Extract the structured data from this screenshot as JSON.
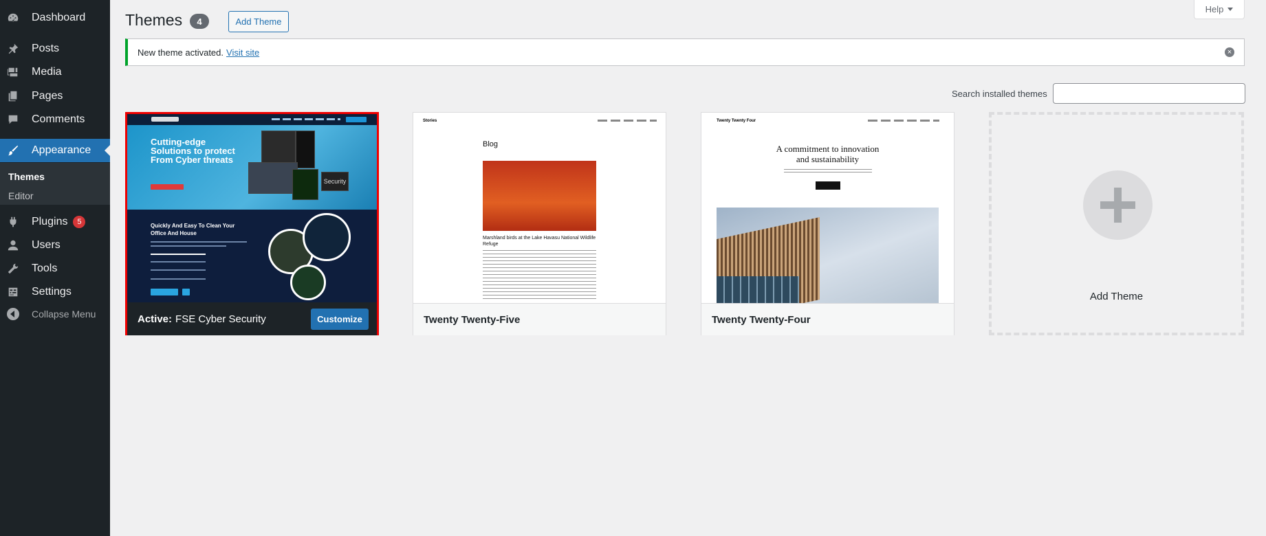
{
  "sidebar": {
    "items": [
      {
        "key": "dashboard",
        "label": "Dashboard",
        "icon": "dashboard-icon"
      },
      {
        "key": "posts",
        "label": "Posts",
        "icon": "pin-icon"
      },
      {
        "key": "media",
        "label": "Media",
        "icon": "media-icon"
      },
      {
        "key": "pages",
        "label": "Pages",
        "icon": "pages-icon"
      },
      {
        "key": "comments",
        "label": "Comments",
        "icon": "comment-icon"
      },
      {
        "key": "appearance",
        "label": "Appearance",
        "icon": "paintbrush-icon"
      },
      {
        "key": "plugins",
        "label": "Plugins",
        "icon": "plug-icon",
        "badge": "5"
      },
      {
        "key": "users",
        "label": "Users",
        "icon": "user-icon"
      },
      {
        "key": "tools",
        "label": "Tools",
        "icon": "wrench-icon"
      },
      {
        "key": "settings",
        "label": "Settings",
        "icon": "settings-icon"
      }
    ],
    "submenu": [
      "Themes",
      "Editor"
    ],
    "collapse_label": "Collapse Menu"
  },
  "header": {
    "title": "Themes",
    "count": "4",
    "add_button": "Add Theme",
    "help": "Help"
  },
  "notice": {
    "text": "New theme activated.",
    "link": "Visit site"
  },
  "search": {
    "label": "Search installed themes",
    "value": ""
  },
  "themes": {
    "active": {
      "active_label": "Active:",
      "name": "FSE Cyber Security",
      "customize": "Customize",
      "preview": {
        "headline": "Cutting-edge Solutions to protect From Cyber threats",
        "subheading": "Quickly And Easy To Clean Your Office And House",
        "security_tag": "Security"
      }
    },
    "twenty_five": {
      "name": "Twenty Twenty-Five",
      "preview": {
        "brand": "Stories",
        "heading": "Blog",
        "caption": "Marshland birds at the Lake Havasu National Wildlife Refuge"
      }
    },
    "twenty_four": {
      "name": "Twenty Twenty-Four",
      "preview": {
        "brand": "Twenty Twenty Four",
        "headline": "A commitment to innovation and sustainability"
      }
    },
    "add_new": "Add Theme"
  },
  "colors": {
    "accent": "#2271b1",
    "sidebar": "#1d2327",
    "notice_success": "#00a32a",
    "badge": "#d63638",
    "active_outline": "#ee0000"
  }
}
